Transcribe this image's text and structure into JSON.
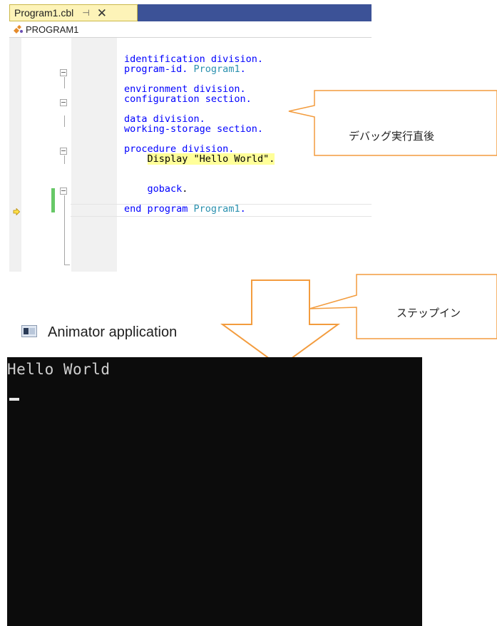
{
  "editor": {
    "tab": {
      "title": "Program1.cbl",
      "pin_glyph": "⊣",
      "close_glyph": "✕"
    },
    "nav": {
      "label": "PROGRAM1",
      "icon": "class-icon"
    },
    "lines": [
      {
        "parts": [
          {
            "t": "identification division.",
            "c": "kw"
          }
        ]
      },
      {
        "parts": [
          {
            "t": "program-id. ",
            "c": "kw"
          },
          {
            "t": "Program1",
            "c": "id"
          },
          {
            "t": ".",
            "c": "kw"
          }
        ]
      },
      {
        "parts": []
      },
      {
        "parts": [
          {
            "t": "environment division.",
            "c": "kw"
          }
        ]
      },
      {
        "parts": [
          {
            "t": "configuration section.",
            "c": "kw"
          }
        ]
      },
      {
        "parts": []
      },
      {
        "parts": [
          {
            "t": "data division.",
            "c": "kw"
          }
        ]
      },
      {
        "parts": [
          {
            "t": "working-storage section.",
            "c": "kw"
          }
        ]
      },
      {
        "parts": []
      },
      {
        "parts": [
          {
            "t": "procedure division.",
            "c": "kw"
          }
        ]
      },
      {
        "parts": [
          {
            "t": "    ",
            "c": "plain"
          },
          {
            "t": "Display \"Hello World\".",
            "c": "hl"
          }
        ]
      },
      {
        "parts": []
      },
      {
        "parts": [
          {
            "t": "    ",
            "c": "plain"
          },
          {
            "t": "goback",
            "c": "kw"
          },
          {
            "t": ".",
            "c": "plain"
          }
        ]
      },
      {
        "parts": []
      },
      {
        "parts": [
          {
            "t": "end program ",
            "c": "kw"
          },
          {
            "t": "Program1",
            "c": "id"
          },
          {
            "t": ".",
            "c": "kw"
          }
        ]
      }
    ],
    "current_line_icon": "execution-arrow-icon"
  },
  "callouts": {
    "top": "デバッグ実行直後",
    "bottom": "ステップイン",
    "arrow_icon": "down-arrow-icon"
  },
  "console": {
    "title": "Animator application",
    "icon": "console-window-icon",
    "output": "Hello World"
  },
  "colors": {
    "tab_bg": "#fdf3b8",
    "tabstrip_bg": "#3c5297",
    "callout_border": "#f39c3e",
    "keyword": "#0000ff",
    "identifier": "#2b91af",
    "highlight": "#ffff99",
    "console_bg": "#0c0c0c"
  }
}
